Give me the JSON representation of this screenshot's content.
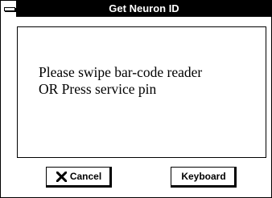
{
  "window": {
    "title": "Get Neuron ID"
  },
  "message": {
    "line1": "Please swipe bar-code reader",
    "line2": "OR Press service pin"
  },
  "buttons": {
    "cancel": {
      "label": "Cancel",
      "icon": "x-icon"
    },
    "keyboard": {
      "label": "Keyboard"
    }
  }
}
